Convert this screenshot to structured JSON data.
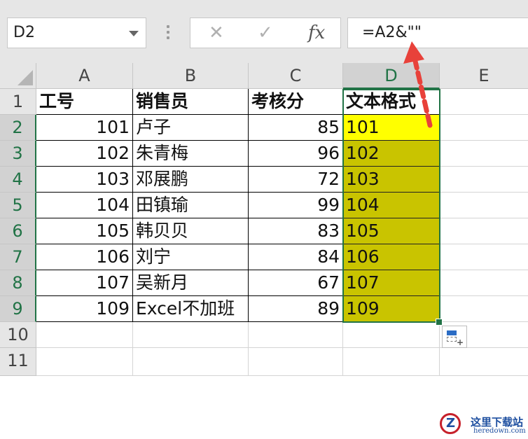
{
  "formula_bar": {
    "name_box": "D2",
    "cancel_glyph": "✕",
    "enter_glyph": "✓",
    "fx_label": "fx",
    "formula": "=A2&\"\""
  },
  "columns": [
    "A",
    "B",
    "C",
    "D",
    "E"
  ],
  "rows": [
    "1",
    "2",
    "3",
    "4",
    "5",
    "6",
    "7",
    "8",
    "9",
    "10",
    "11"
  ],
  "header": {
    "a": "工号",
    "b": "销售员",
    "c": "考核分",
    "d": "文本格式"
  },
  "records": [
    {
      "id": "101",
      "name": "卢子",
      "score": "85",
      "text": "101"
    },
    {
      "id": "102",
      "name": "朱青梅",
      "score": "96",
      "text": "102"
    },
    {
      "id": "103",
      "name": "邓展鹏",
      "score": "72",
      "text": "103"
    },
    {
      "id": "104",
      "name": "田镇瑜",
      "score": "99",
      "text": "104"
    },
    {
      "id": "105",
      "name": "韩贝贝",
      "score": "83",
      "text": "105"
    },
    {
      "id": "106",
      "name": "刘宁",
      "score": "84",
      "text": "106"
    },
    {
      "id": "107",
      "name": "吴新月",
      "score": "67",
      "text": "107"
    },
    {
      "id": "109",
      "name": "Excel不加班",
      "score": "89",
      "text": "109"
    }
  ],
  "colors": {
    "selection": "#217346",
    "active_fill": "#ffff00",
    "range_fill": "#c9c400",
    "arrow": "#e8413a"
  },
  "watermark": {
    "title": "这里下载站",
    "url": "heredown.com"
  }
}
